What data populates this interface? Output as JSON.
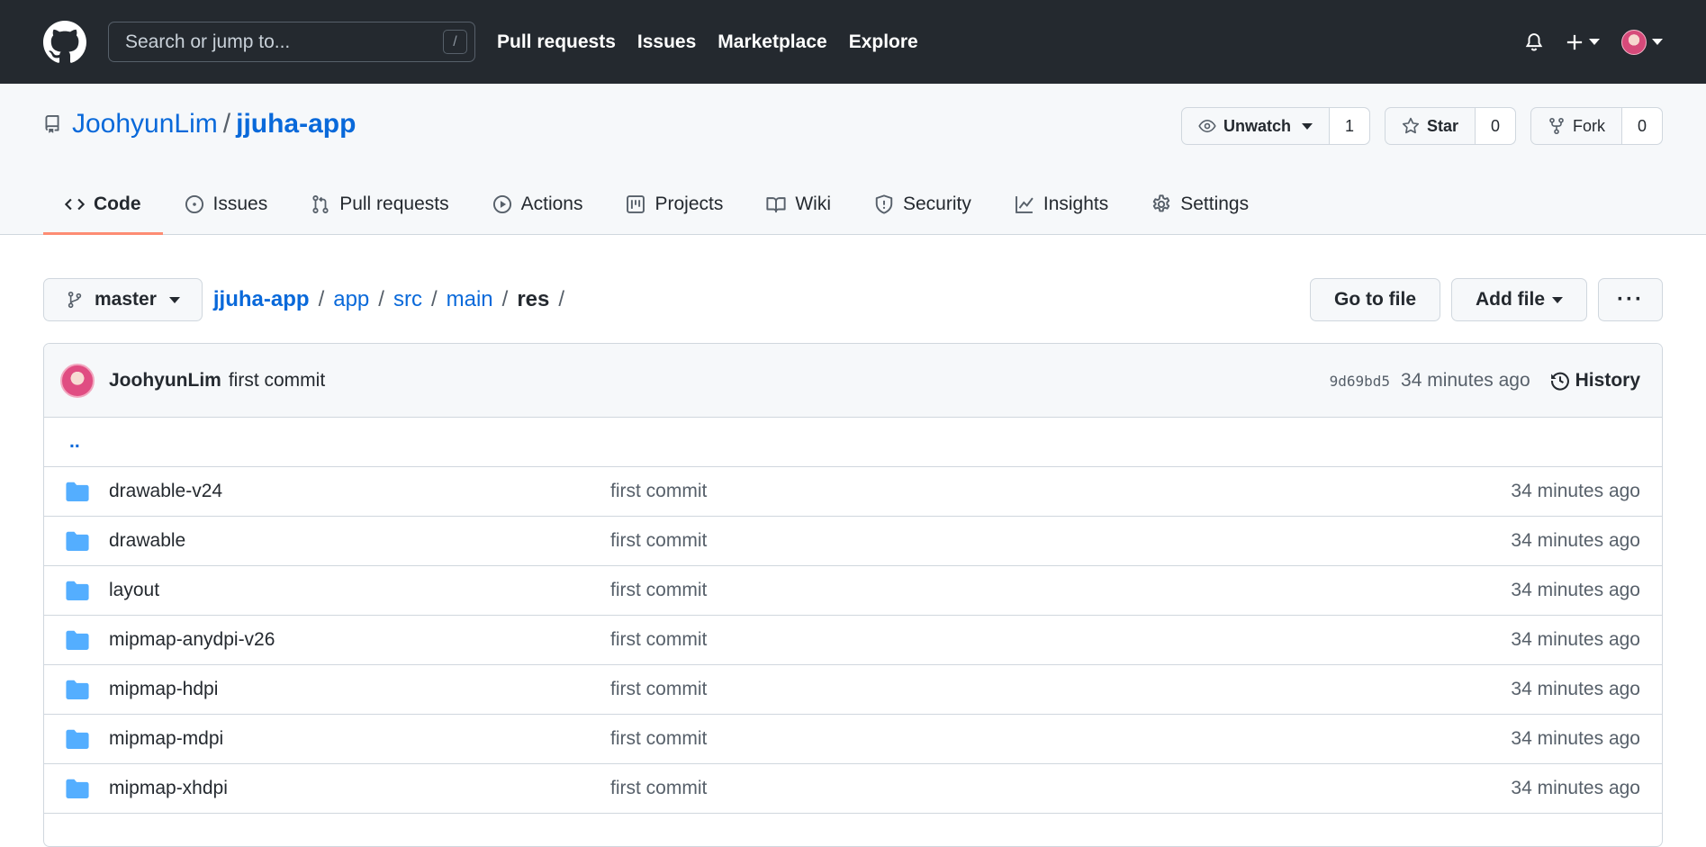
{
  "header": {
    "search_placeholder": "Search or jump to...",
    "search_shortcut": "/",
    "nav": [
      "Pull requests",
      "Issues",
      "Marketplace",
      "Explore"
    ]
  },
  "repo": {
    "owner": "JoohyunLim",
    "separator": "/",
    "name": "jjuha-app",
    "watch_label": "Unwatch",
    "watch_count": "1",
    "star_label": "Star",
    "star_count": "0",
    "fork_label": "Fork",
    "fork_count": "0"
  },
  "tabs": [
    {
      "label": "Code",
      "icon": "code-icon",
      "active": true
    },
    {
      "label": "Issues",
      "icon": "issue-opened-icon"
    },
    {
      "label": "Pull requests",
      "icon": "git-pull-request-icon"
    },
    {
      "label": "Actions",
      "icon": "play-icon"
    },
    {
      "label": "Projects",
      "icon": "project-icon"
    },
    {
      "label": "Wiki",
      "icon": "book-icon"
    },
    {
      "label": "Security",
      "icon": "shield-icon"
    },
    {
      "label": "Insights",
      "icon": "graph-icon"
    },
    {
      "label": "Settings",
      "icon": "gear-icon"
    }
  ],
  "branch": {
    "name": "master"
  },
  "breadcrumb": {
    "parts": [
      "jjuha-app",
      "app",
      "src",
      "main"
    ],
    "current": "res",
    "trailing": "/"
  },
  "buttons": {
    "go_to_file": "Go to file",
    "add_file": "Add file",
    "more": "···"
  },
  "commit": {
    "author": "JoohyunLim",
    "message": "first commit",
    "sha": "9d69bd5",
    "time": "34 minutes ago",
    "history_label": "History"
  },
  "parent_dir": "..",
  "files": [
    {
      "name": "drawable-v24",
      "message": "first commit",
      "time": "34 minutes ago"
    },
    {
      "name": "drawable",
      "message": "first commit",
      "time": "34 minutes ago"
    },
    {
      "name": "layout",
      "message": "first commit",
      "time": "34 minutes ago"
    },
    {
      "name": "mipmap-anydpi-v26",
      "message": "first commit",
      "time": "34 minutes ago"
    },
    {
      "name": "mipmap-hdpi",
      "message": "first commit",
      "time": "34 minutes ago"
    },
    {
      "name": "mipmap-mdpi",
      "message": "first commit",
      "time": "34 minutes ago"
    },
    {
      "name": "mipmap-xhdpi",
      "message": "first commit",
      "time": "34 minutes ago"
    }
  ],
  "colors": {
    "header_bg": "#24292f",
    "link": "#0969da",
    "folder": "#54aeff",
    "active_tab_underline": "#fd8c73"
  }
}
